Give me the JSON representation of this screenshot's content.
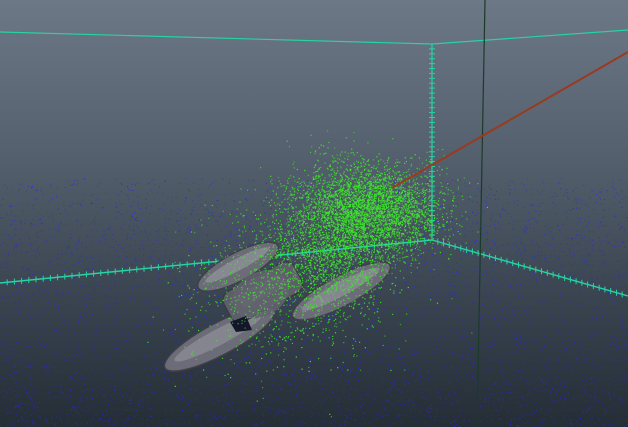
{
  "viewport": {
    "background_top": "#6c7886",
    "background_bottom": "#252d35",
    "grid_color": "#27d3a3",
    "ray_color": "#9a3a1f",
    "axis_color": "#1c3a2a",
    "ambient_particle_color": "#2a2ad8",
    "emitter_particle_color": "#3dea2a",
    "mesh_color": "#6e6e7a"
  },
  "objects": [
    {
      "name": "bounding-grid",
      "icon": "grid-icon"
    },
    {
      "name": "particle-field",
      "icon": "particles-icon"
    },
    {
      "name": "particle-emitter-cloud",
      "icon": "emitter-icon"
    },
    {
      "name": "spaceship-mesh",
      "icon": "mesh-icon"
    },
    {
      "name": "direction-ray",
      "icon": "ray-icon"
    }
  ]
}
